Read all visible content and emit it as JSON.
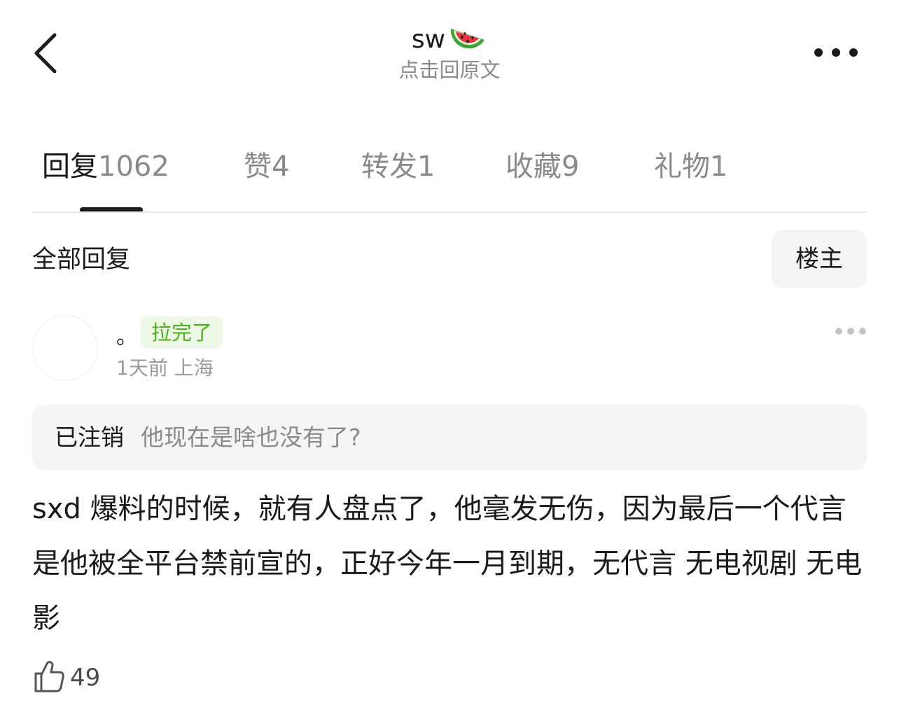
{
  "header": {
    "title": "sw",
    "subtitle": "点击回原文"
  },
  "icons": {
    "back": "chevron-left-icon",
    "title_emoji": "watermelon-icon",
    "more": "more-horizontal-icon",
    "like": "thumbs-up-icon"
  },
  "tabs": [
    {
      "label": "回复",
      "count": "1062",
      "active": true
    },
    {
      "label": "赞",
      "count": "4",
      "active": false
    },
    {
      "label": "转发",
      "count": "1",
      "active": false
    },
    {
      "label": "收藏",
      "count": "9",
      "active": false
    },
    {
      "label": "礼物",
      "count": "1",
      "active": false
    }
  ],
  "section": {
    "title": "全部回复",
    "op_button": "楼主"
  },
  "comment": {
    "username": "。",
    "badge": "拉完了",
    "time": "1天前",
    "location": "上海",
    "quote_user": "已注销",
    "quote_text": "他现在是啥也没有了?",
    "body": "sxd 爆料的时候，就有人盘点了，他毫发无伤，因为最后一个代言是他被全平台禁前宣的，正好今年一月到期，无代言 无电视剧 无电影",
    "likes": "49"
  },
  "colors": {
    "badge_bg": "#eef8e6",
    "badge_text": "#4caf1c",
    "muted": "#8a8a8a",
    "text": "#1a1a1a"
  }
}
